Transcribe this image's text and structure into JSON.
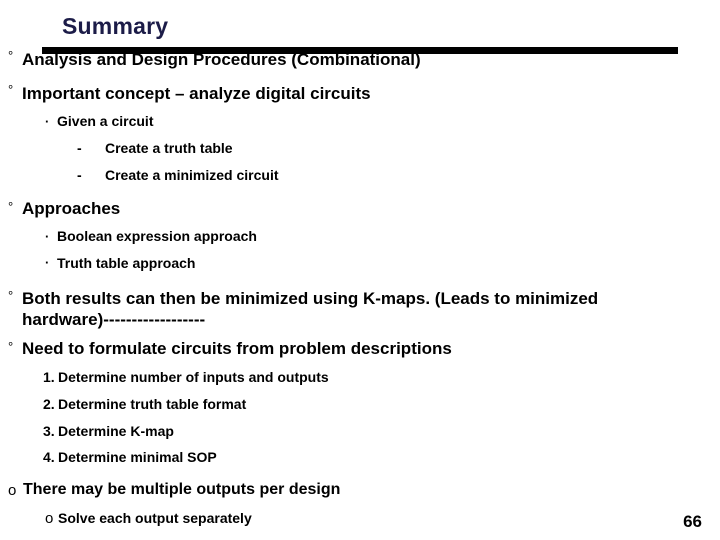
{
  "slide": {
    "title": "Summary",
    "title_color": "#1c1c48",
    "rule_color": "#000000",
    "background": "#ffffff",
    "page_number": "66"
  },
  "bullets": {
    "degree_glyph": "°",
    "dot_glyph": "·",
    "dash_glyph": "-",
    "o_glyph": "o"
  },
  "content": [
    {
      "level": 1,
      "marker": "°",
      "text": "Analysis and Design Procedures (Combinational)"
    },
    {
      "level": 1,
      "marker": "°",
      "text": "Important concept – analyze digital circuits"
    },
    {
      "level": 2,
      "marker": "·",
      "text": "Given a circuit"
    },
    {
      "level": 3,
      "marker": "-",
      "text": "Create a truth table"
    },
    {
      "level": 3,
      "marker": "-",
      "text": "Create a minimized circuit"
    },
    {
      "level": 1,
      "marker": "°",
      "text": "Approaches"
    },
    {
      "level": 2,
      "marker": "·",
      "text": "Boolean expression approach"
    },
    {
      "level": 2,
      "marker": "·",
      "text": "Truth table approach"
    },
    {
      "level": 1,
      "marker": "°",
      "text_line1": "Both results can then be minimized using K-maps. (Leads to minimized",
      "text_line2": "hardware)------------------"
    },
    {
      "level": 1,
      "marker": "°",
      "text": "Need to formulate circuits from problem descriptions"
    },
    {
      "level": "num",
      "marker": "1.",
      "text": "Determine number of inputs and outputs"
    },
    {
      "level": "num",
      "marker": "2.",
      "text": "Determine truth table format"
    },
    {
      "level": "num",
      "marker": "3.",
      "text": "Determine K-map"
    },
    {
      "level": "num",
      "marker": "4.",
      "text": "Determine minimal SOP"
    },
    {
      "level": 1,
      "marker": "o",
      "text": "There may be multiple outputs per design"
    },
    {
      "level": 2,
      "marker": "o",
      "text": "Solve each output separately"
    }
  ]
}
